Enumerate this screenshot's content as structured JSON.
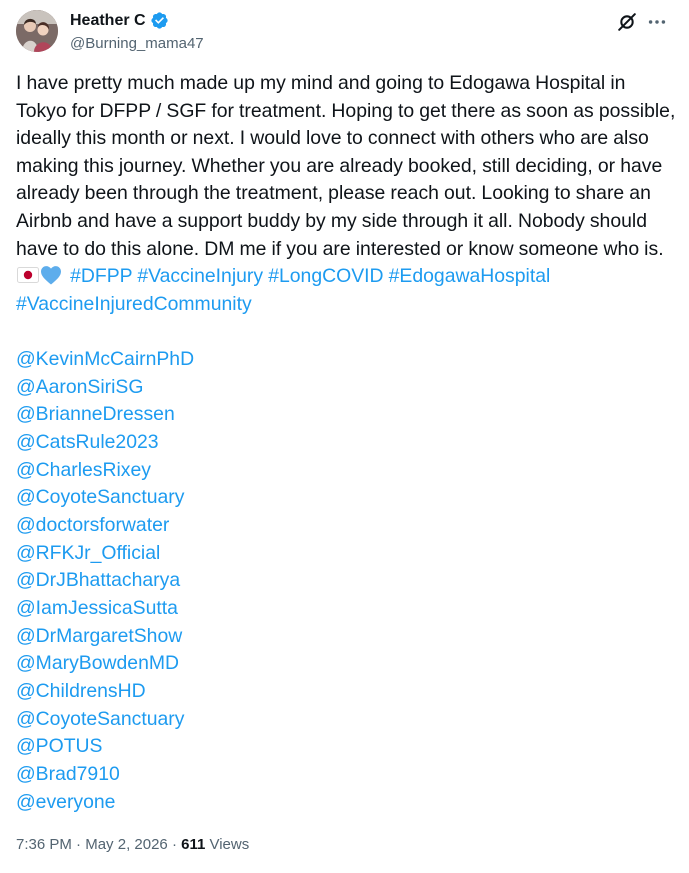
{
  "author": {
    "display_name": "Heather C",
    "handle": "@Burning_mama47",
    "avatar_icon": "avatar-photo",
    "verified_icon": "verified-badge-icon",
    "verified_color": "#1d9bf0"
  },
  "actions": {
    "grok_icon": "grok-icon",
    "more_icon": "more-horizontal-icon"
  },
  "tweet": {
    "text_part1": "I have pretty much made up my mind and going to Edogawa Hospital in Tokyo for DFPP / SGF for treatment. Hoping to get there as soon as possible, ideally this month or next. I would love to connect with others who are also making this journey. Whether you are already booked, still deciding, or have already been through the treatment, please reach out. Looking to share an Airbnb and have a support buddy by my side through it all. Nobody should have to do this alone. DM me if you are interested or know someone who is.",
    "emoji_flag": "japan-flag-emoji",
    "emoji_heart": "blue-heart-emoji",
    "hashtags": [
      "#DFPP",
      "#VaccineInjury",
      "#LongCOVID",
      "#EdogawaHospital",
      "#VaccineInjuredCommunity"
    ],
    "mentions": [
      "@KevinMcCairnPhD",
      "@AaronSiriSG",
      "@BrianneDressen",
      "@CatsRule2023",
      "@CharlesRixey",
      "@CoyoteSanctuary",
      "@doctorsforwater",
      "@RFKJr_Official",
      "@DrJBhattacharya",
      "@IamJessicaSutta",
      "@DrMargaretShow",
      "@MaryBowdenMD",
      "@ChildrensHD",
      "@CoyoteSanctuary",
      "@POTUS",
      "@Brad7910",
      "@everyone"
    ]
  },
  "meta": {
    "time": "7:36 PM",
    "separator": " · ",
    "date": "May 2, 2026",
    "views_count": "611",
    "views_label": " Views"
  },
  "colors": {
    "link": "#1d9bf0",
    "text": "#0f1419",
    "secondary": "#536471"
  }
}
